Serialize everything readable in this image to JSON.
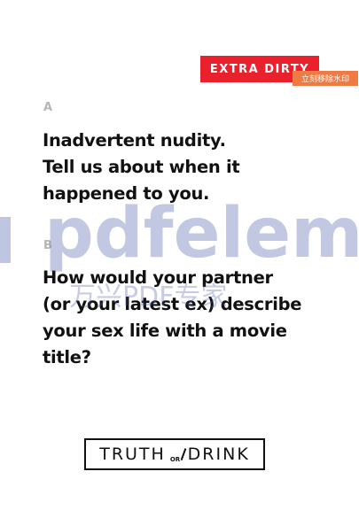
{
  "badge": {
    "label": "EXTRA DIRTY"
  },
  "watermark": {
    "remove_label": "立刻移除水印",
    "brand": "pdfeleme",
    "brand_cn": "万兴PDF专家",
    "color": "#4a5aa8"
  },
  "questions": [
    {
      "letter": "A",
      "lines": [
        "Inadvertent nudity.",
        "Tell us about when it",
        "happened to you."
      ]
    },
    {
      "letter": "B",
      "lines": [
        "How would your partner",
        "(or your latest ex) describe",
        "your sex life with a movie",
        "title?"
      ]
    }
  ],
  "logo": {
    "left": "TRUTH",
    "middle": "OR",
    "right": "DRINK"
  },
  "colors": {
    "badge": "#e8212c",
    "remove": "#f07a44",
    "text": "#111111",
    "letter": "#b5b5b5"
  }
}
